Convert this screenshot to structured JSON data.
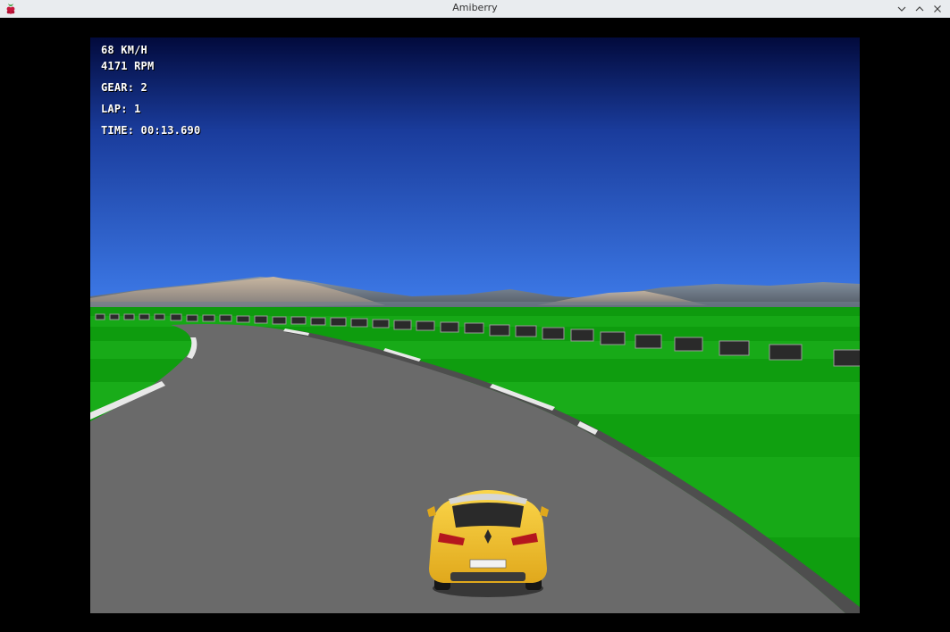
{
  "window": {
    "title": "Amiberry",
    "app_icon": "raspberry-icon",
    "controls": [
      "minimize-icon",
      "maximize-icon",
      "close-icon"
    ]
  },
  "hud": {
    "speed": "68 KM/H",
    "rpm": "4171 RPM",
    "gear": "GEAR: 2",
    "lap": "LAP: 1",
    "time": "TIME: 00:13.690"
  },
  "colors": {
    "sky_top": "#020a3c",
    "sky_bottom": "#3d7ae8",
    "grass": "#18a818",
    "road": "#6a6a6a",
    "car": "#f5c430"
  }
}
